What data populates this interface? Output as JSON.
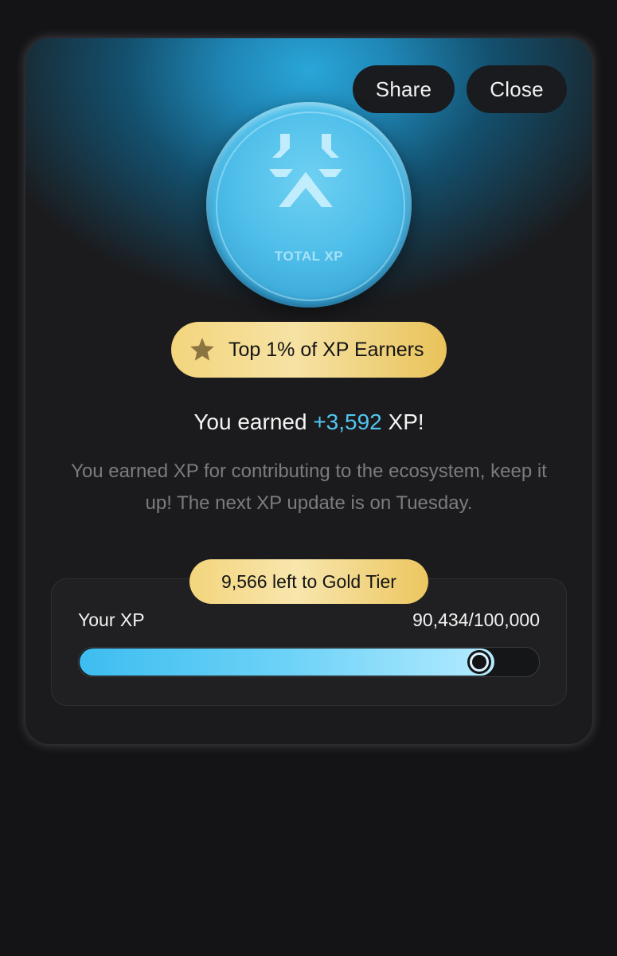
{
  "header": {
    "share_label": "Share",
    "close_label": "Close"
  },
  "coin": {
    "label": "TOTAL XP",
    "icon": "xp-logo-icon"
  },
  "badge": {
    "icon": "star-icon",
    "label": "Top 1% of XP Earners"
  },
  "earned": {
    "prefix": "You earned ",
    "amount": "+3,592",
    "suffix": " XP!"
  },
  "description": "You earned XP for contributing to the ecosystem, keep it up! The next XP update is on Tuesday.",
  "progress": {
    "tier_label": "9,566 left to Gold Tier",
    "label": "Your XP",
    "count": "90,434/100,000",
    "current": 90434,
    "max": 100000
  },
  "colors": {
    "accent": "#52c6f2",
    "gold": "#f3d57d",
    "background": "#141416",
    "card": "#1b1b1d"
  }
}
